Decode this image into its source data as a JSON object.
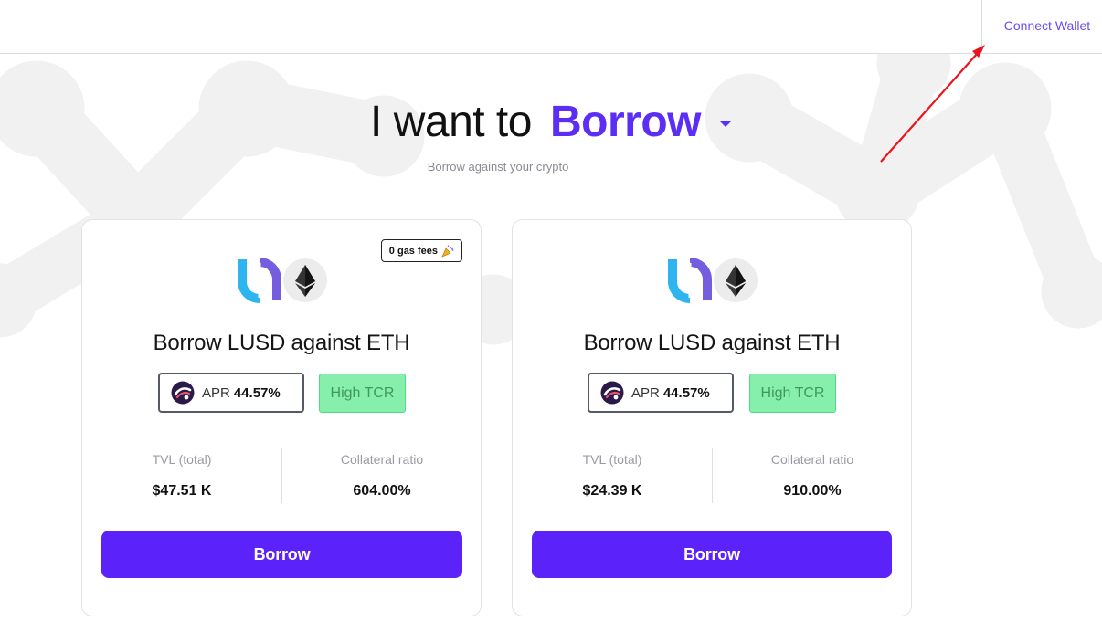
{
  "header": {
    "connect_wallet_label": "Connect Wallet"
  },
  "hero": {
    "prefix": "I want to",
    "action": "Borrow",
    "subtitle": "Borrow against your crypto"
  },
  "cards": [
    {
      "gas_badge": "0 gas fees",
      "gas_badge_icon": "party-popper-icon",
      "tokens": [
        "lusd-icon",
        "eth-icon"
      ],
      "title": "Borrow LUSD against ETH",
      "apr_label": "APR",
      "apr_value": "44.57%",
      "status_badge": "High TCR",
      "tvl_label": "TVL (total)",
      "tvl_value": "$47.51 K",
      "collateral_label": "Collateral ratio",
      "collateral_value": "604.00%",
      "button_label": "Borrow"
    },
    {
      "tokens": [
        "lusd-icon",
        "eth-icon"
      ],
      "title": "Borrow LUSD against ETH",
      "apr_label": "APR",
      "apr_value": "44.57%",
      "status_badge": "High TCR",
      "tvl_label": "TVL (total)",
      "tvl_value": "$24.39 K",
      "collateral_label": "Collateral ratio",
      "collateral_value": "910.00%",
      "button_label": "Borrow"
    }
  ],
  "colors": {
    "accent": "#5b23fa",
    "link": "#6a4cf5",
    "success_bg": "#86efac",
    "annotation_arrow": "#e8141b"
  }
}
